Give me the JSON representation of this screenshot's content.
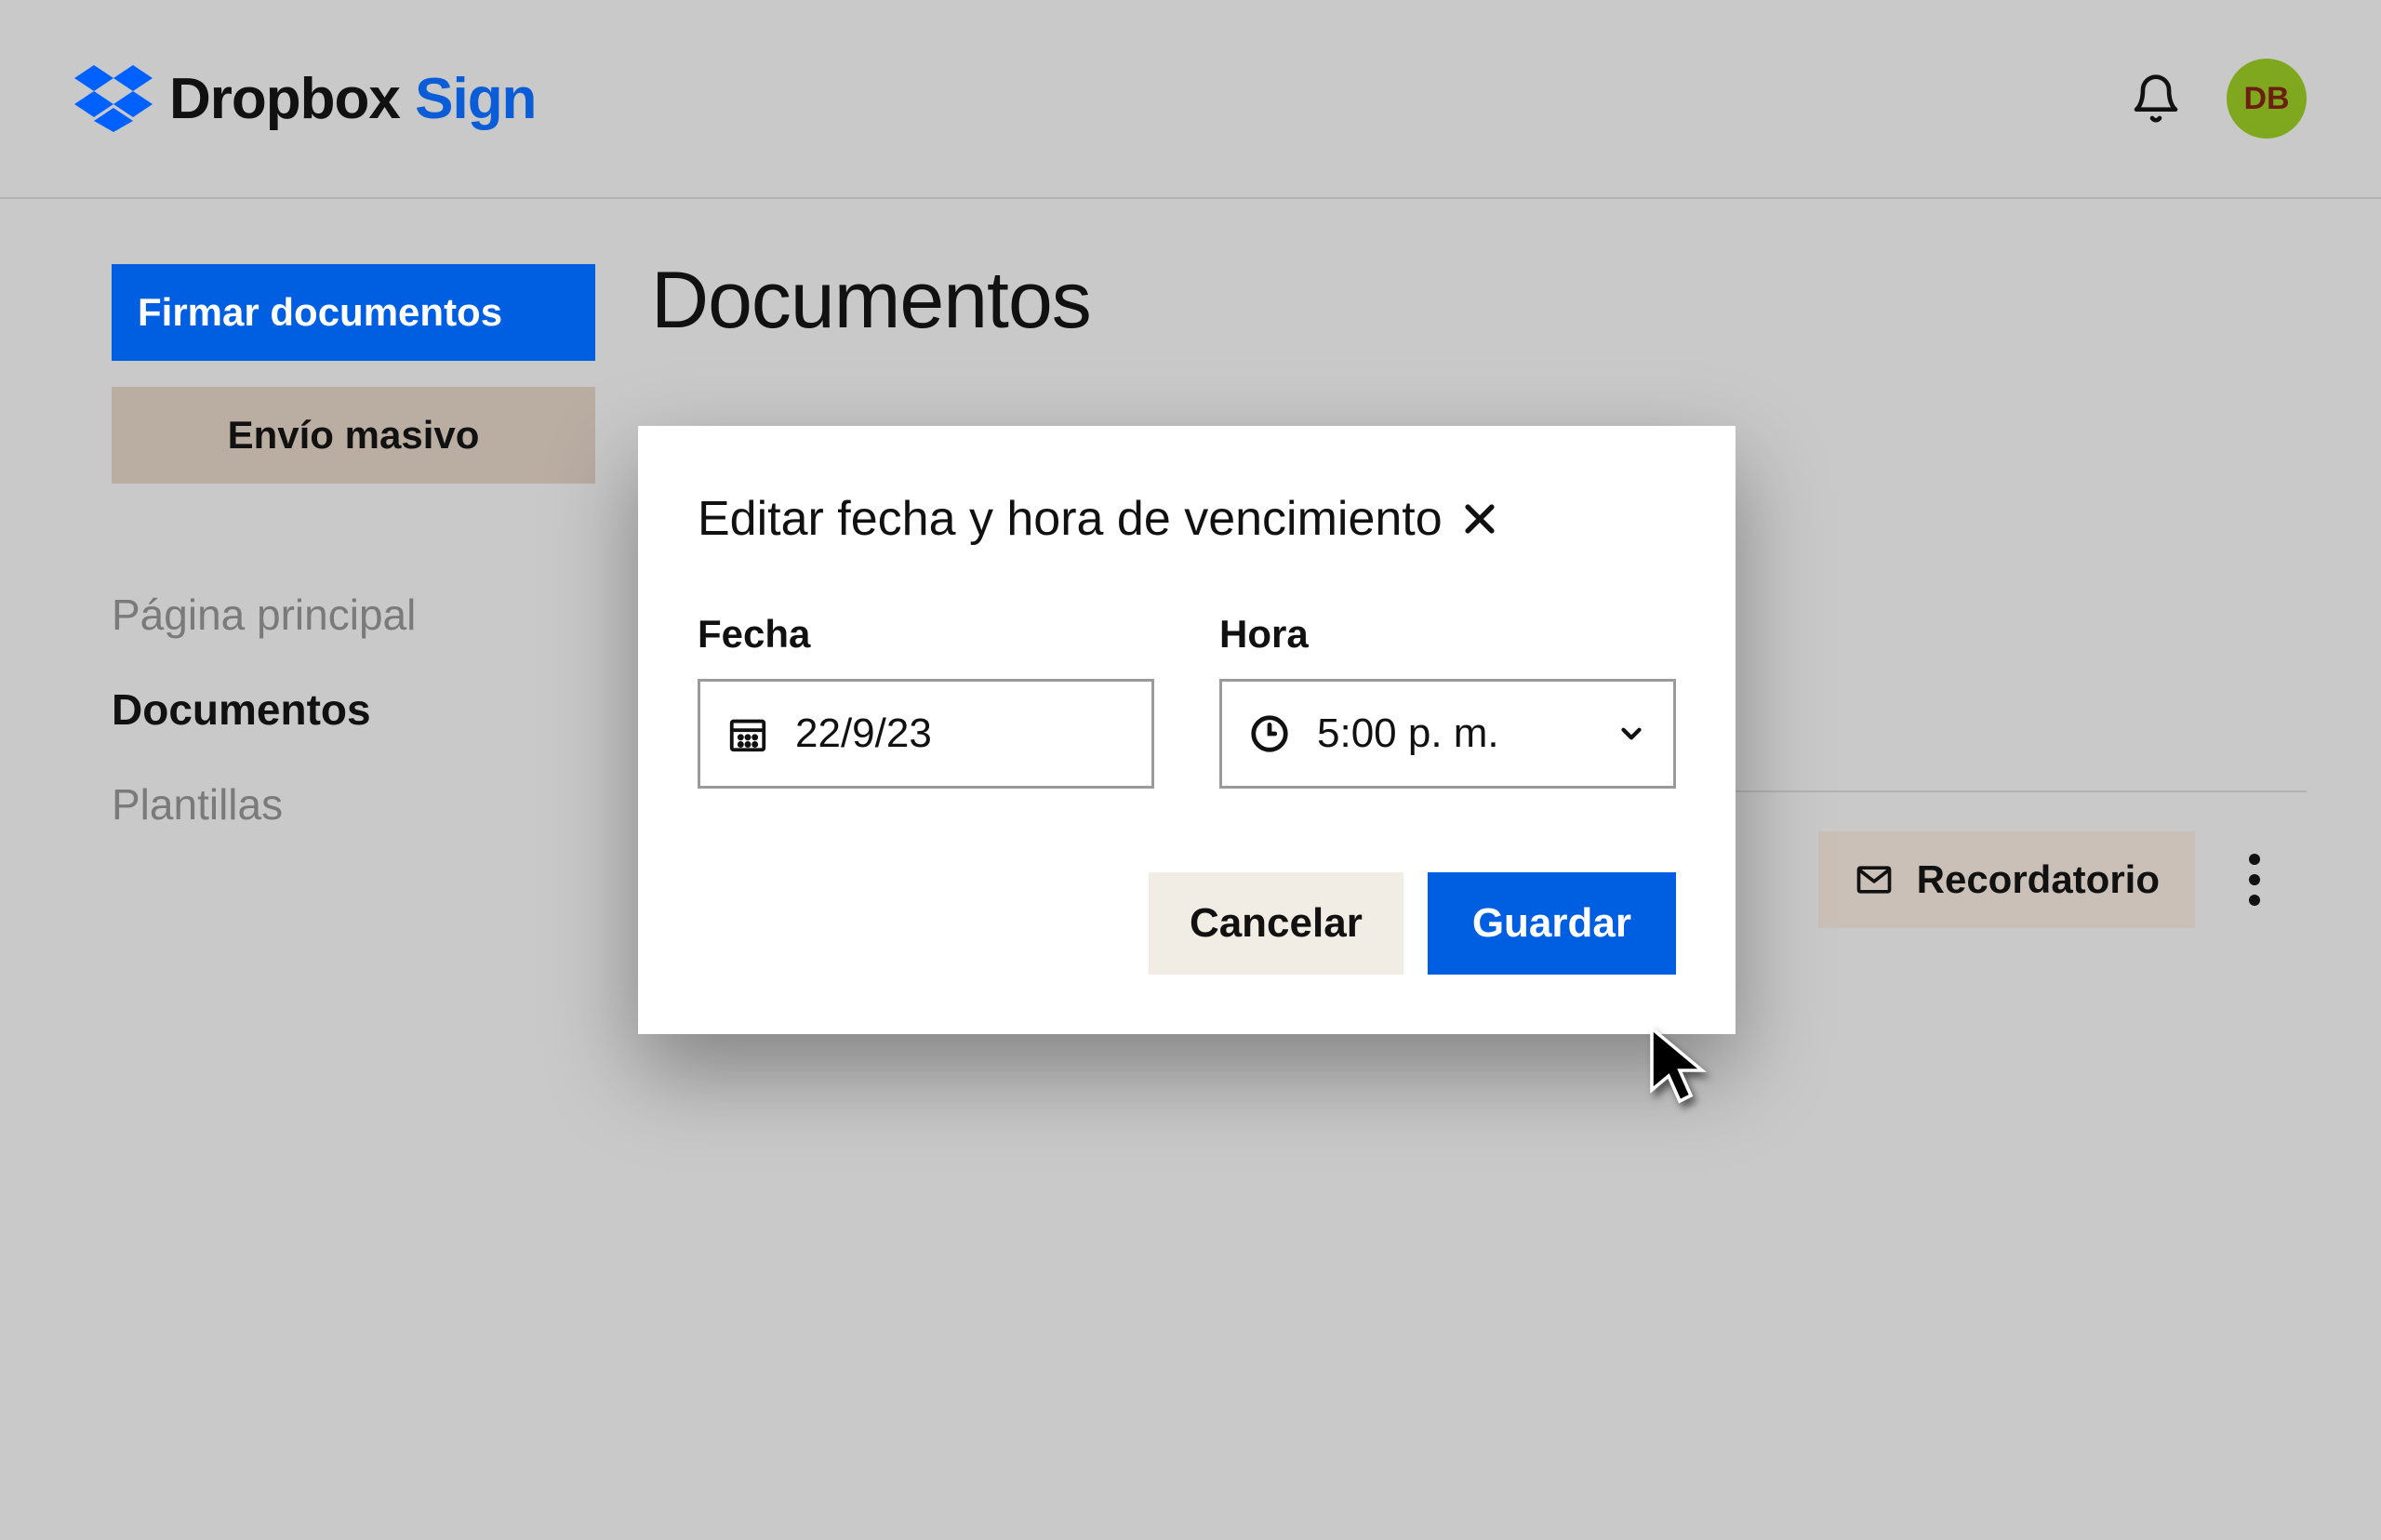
{
  "header": {
    "brand_dbx": "Dropbox",
    "brand_sign": "Sign",
    "avatar_initials": "DB"
  },
  "sidebar": {
    "sign_button": "Firmar documentos",
    "bulk_button": "Envío masivo",
    "nav": {
      "home": "Página principal",
      "documents": "Documentos",
      "templates": "Plantillas"
    }
  },
  "main": {
    "title": "Documentos",
    "reminder_button": "Recordatorio"
  },
  "modal": {
    "title": "Editar fecha y hora de vencimiento",
    "date_label": "Fecha",
    "date_value": "22/9/23",
    "time_label": "Hora",
    "time_value": "5:00 p. m.",
    "cancel": "Cancelar",
    "save": "Guardar"
  }
}
